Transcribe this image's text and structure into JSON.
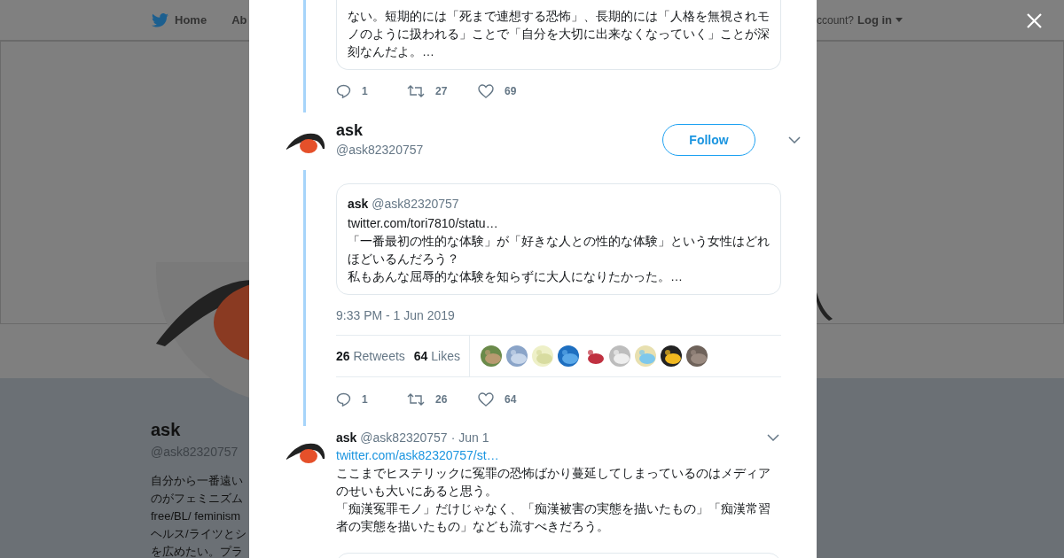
{
  "header": {
    "nav": [
      "Home",
      "Ab"
    ],
    "login_prompt": "ccount?",
    "login_link": "Log in"
  },
  "profile": {
    "name": "ask",
    "handle": "@ask82320757",
    "bio_lines": [
      "自分から一番遠い",
      "のがフェミニズム",
      "free/BL/ feminism",
      "ヘルス/ライツとシ",
      "を広めたい。プラ"
    ]
  },
  "thread": [
    {
      "kind": "context",
      "quote_text": "ない。短期的には「死まで連想する恐怖」、長期的には「人格を無視されモノのように扱われる」ことで「自分を大切に出来なくなっていく」ことが深刻なんだよ。…",
      "replies": "1",
      "retweets": "27",
      "likes": "69"
    },
    {
      "kind": "focused",
      "name": "ask",
      "handle": "@ask82320757",
      "follow_label": "Follow",
      "quote": {
        "name": "ask",
        "handle": "@ask82320757",
        "paragraphs": [
          "twitter.com/tori7810/statu…",
          "「一番最初の性的な体験」が「好きな人との性的な体験」という女性はどれほどいるんだろう？",
          "私もあんな屈辱的な体験を知らずに大人になりたかった。…"
        ]
      },
      "time": "9:33 PM - 1 Jun 2019",
      "retweet_count": "26",
      "retweet_label": "Retweets",
      "like_count": "64",
      "like_label": "Likes",
      "replies": "1",
      "retweets": "26",
      "likes": "64"
    },
    {
      "kind": "reply",
      "name": "ask",
      "handle": "@ask82320757",
      "date": "· Jun 1",
      "link": "twitter.com/ask82320757/st…",
      "paragraphs": [
        "ここまでヒステリックに冤罪の恐怖ばかり蔓延してしまっているのはメディアのせいも大いにあると思う。",
        "「痴漢冤罪モノ」だけじゃなく、「痴漢被害の実態を描いたもの」「痴漢常習者の実態を描いたもの」なども流すべきだろう。"
      ]
    }
  ]
}
